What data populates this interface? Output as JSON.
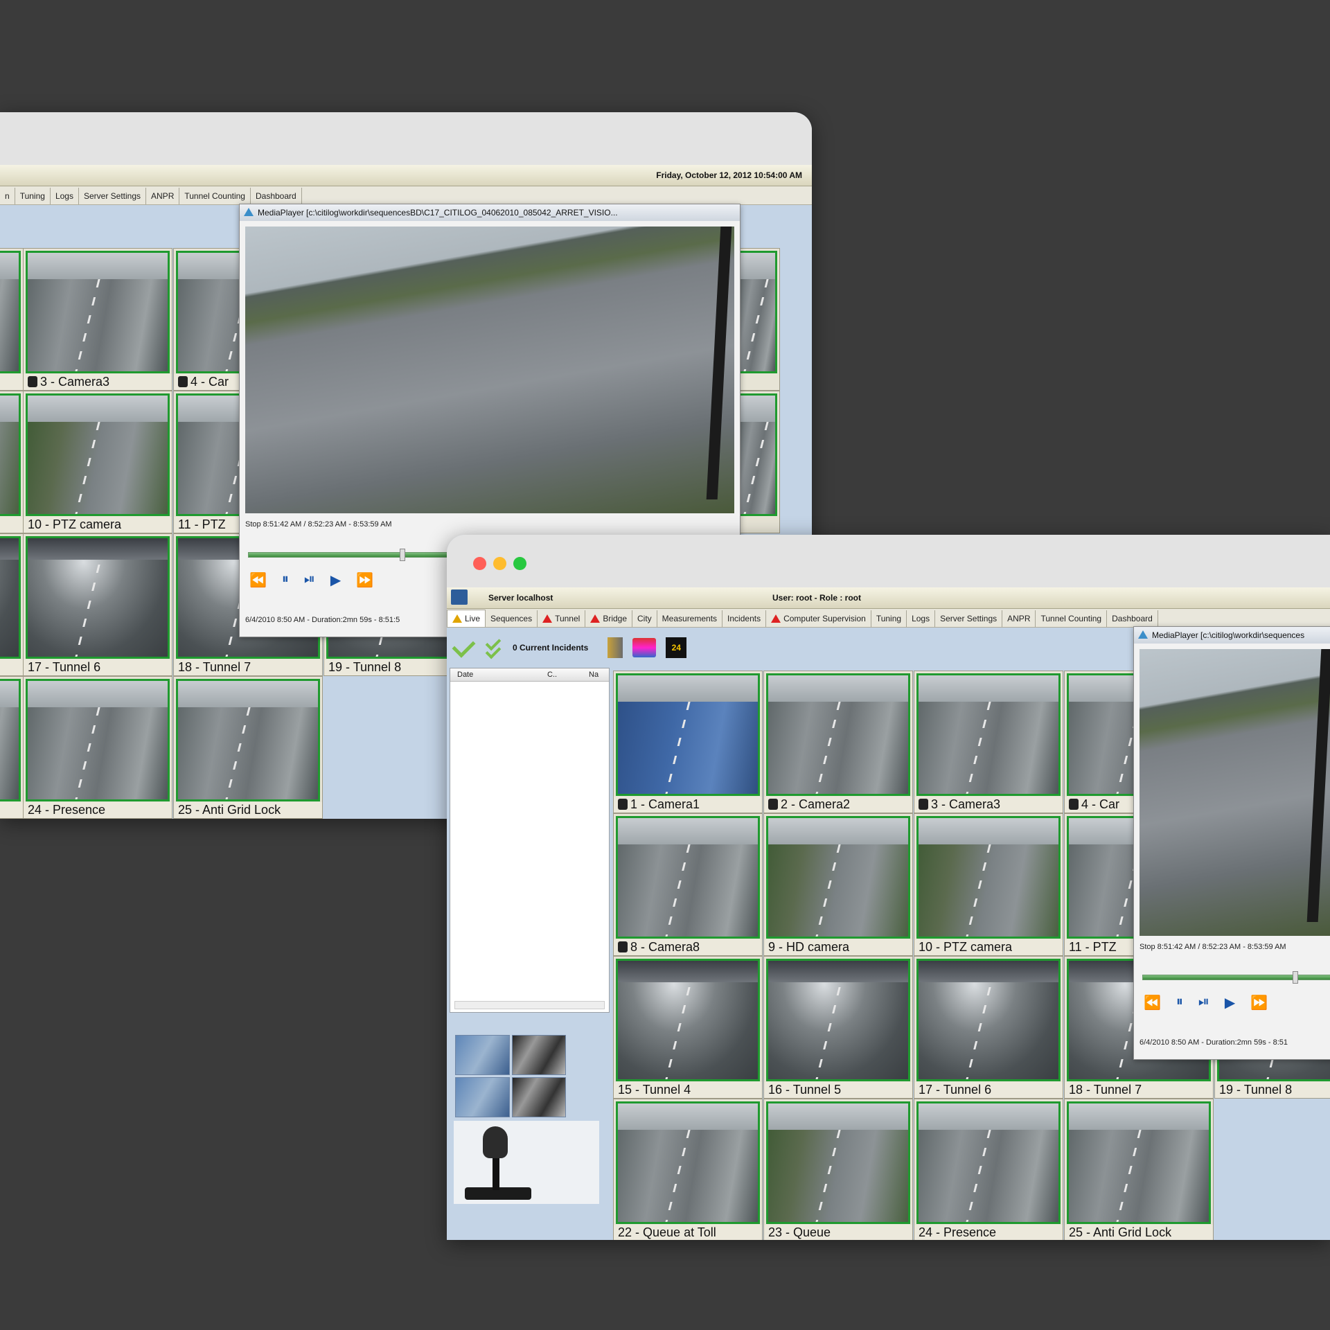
{
  "back_window": {
    "datetime": "Friday, October 12, 2012 10:54:00 AM",
    "tabs": [
      "n",
      "Tuning",
      "Logs",
      "Server Settings",
      "ANPR",
      "Tunnel Counting",
      "Dashboard"
    ],
    "cameras": {
      "r1": [
        "",
        "3 - Camera3",
        "4 - Car"
      ],
      "r2": [
        "",
        "10 - PTZ camera",
        "11 - PTZ"
      ],
      "r3": [
        "",
        "17 - Tunnel 6",
        "18 - Tunnel 7",
        "19 - Tunnel 8"
      ],
      "r4": [
        "",
        "24 - Presence",
        "25 - Anti Grid Lock"
      ]
    },
    "mediaplayer": {
      "title": "MediaPlayer [c:\\citilog\\workdir\\sequencesBD\\C17_CITILOG_04062010_085042_ARRET_VISIO...",
      "status": "Stop 8:51:42 AM / 8:52:23 AM - 8:53:59 AM",
      "footer": "6/4/2010 8:50 AM -    Duration:2mn 59s -   8:51:5"
    }
  },
  "front_window": {
    "server": "Server localhost",
    "user_role": "User: root - Role : root",
    "tabs": [
      {
        "label": "Live",
        "warn": true,
        "active": true
      },
      {
        "label": "Sequences",
        "warn": false
      },
      {
        "label": "Tunnel",
        "warn": true
      },
      {
        "label": "Bridge",
        "warn": true
      },
      {
        "label": "City",
        "warn": false
      },
      {
        "label": "Measurements",
        "warn": false
      },
      {
        "label": "Incidents",
        "warn": false
      },
      {
        "label": "Computer Supervision",
        "warn": true
      },
      {
        "label": "Tuning",
        "warn": false
      },
      {
        "label": "Logs",
        "warn": false
      },
      {
        "label": "Server Settings",
        "warn": false
      },
      {
        "label": "ANPR",
        "warn": false
      },
      {
        "label": "Tunnel Counting",
        "warn": false
      },
      {
        "label": "Dashboard",
        "warn": false
      }
    ],
    "incidents_label": "0 Current Incidents",
    "incident_table_headers": [
      "Date",
      "C..",
      "Na"
    ],
    "cameras": {
      "r1": [
        "1 - Camera1",
        "2 - Camera2",
        "3 - Camera3",
        "4 - Car"
      ],
      "r2": [
        "8 - Camera8",
        "9 - HD camera",
        "10 - PTZ camera",
        "11 - PTZ"
      ],
      "r3": [
        "15 - Tunnel 4",
        "16 - Tunnel 5",
        "17 - Tunnel 6",
        "18 - Tunnel 7",
        "19 - Tunnel 8"
      ],
      "r4": [
        "22 - Queue at Toll",
        "23 - Queue",
        "24 - Presence",
        "25 - Anti Grid Lock"
      ]
    },
    "mediaplayer": {
      "title": "MediaPlayer [c:\\citilog\\workdir\\sequences",
      "status": "Stop 8:51:42 AM / 8:52:23 AM - 8:53:59 AM",
      "footer": "6/4/2010 8:50 AM -    Duration:2mn 59s -   8:51"
    }
  },
  "colors": {
    "desktop": "#3b3b3b",
    "camera_border": "#1f9a2f",
    "traffic_close": "#ff5f57",
    "traffic_min": "#febc2e",
    "traffic_max": "#28c840",
    "side_panel": "#c4d4e6"
  },
  "icons": {
    "ack": "check-icon",
    "ack_all": "double-check-icon",
    "tools": "tools-icon",
    "bus": "bus-icon",
    "24h": "24h-icon",
    "ptz": "joystick-icon"
  }
}
